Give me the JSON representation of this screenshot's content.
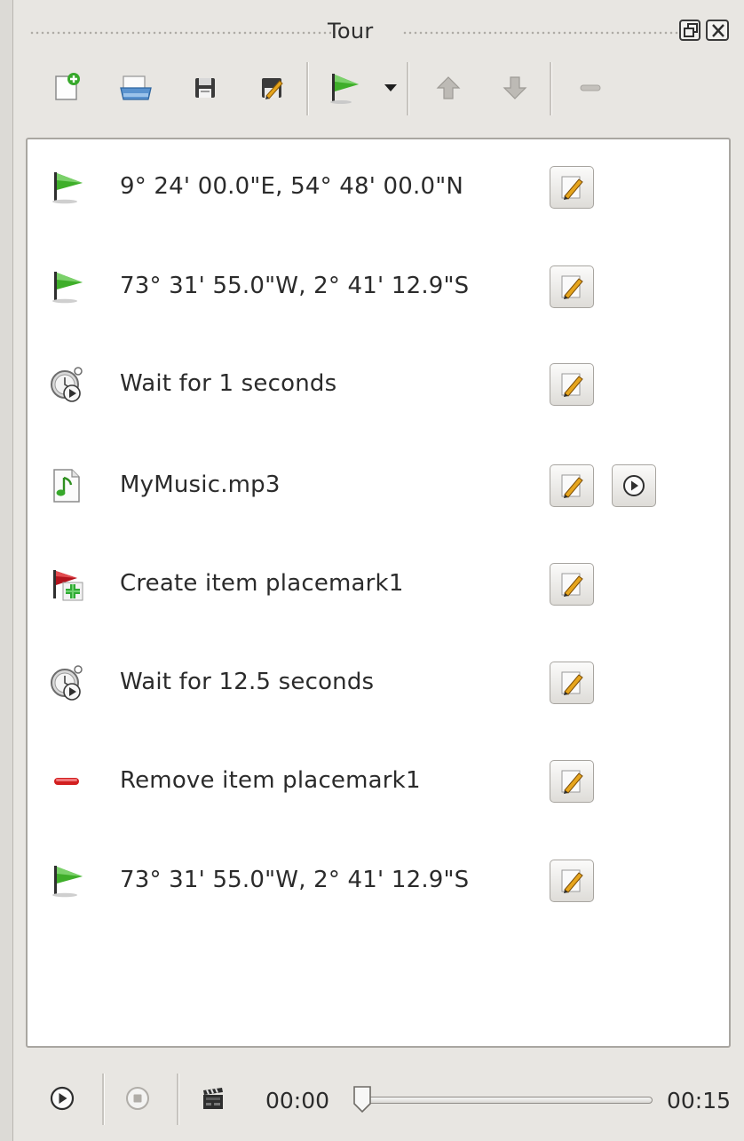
{
  "window": {
    "title": "Tour"
  },
  "toolbar": {
    "buttons": [
      "new-tour",
      "open-tour",
      "save-tour",
      "save-as",
      "add-flyto",
      "add-menu",
      "move-up",
      "move-down",
      "remove"
    ]
  },
  "items": [
    {
      "type": "flyto",
      "icon": "green-flag-icon",
      "label": "9° 24' 00.0\"E, 54° 48' 00.0\"N",
      "playable": false
    },
    {
      "type": "flyto",
      "icon": "green-flag-icon",
      "label": "73° 31' 55.0\"W, 2° 41' 12.9\"S",
      "playable": false
    },
    {
      "type": "wait",
      "icon": "wait-clock-icon",
      "label": "Wait for 1 seconds",
      "playable": false
    },
    {
      "type": "sound",
      "icon": "music-file-icon",
      "label": "MyMusic.mp3",
      "playable": true
    },
    {
      "type": "create",
      "icon": "create-placemark-icon",
      "label": "Create item placemark1",
      "playable": false
    },
    {
      "type": "wait",
      "icon": "wait-clock-icon",
      "label": "Wait for 12.5 seconds",
      "playable": false
    },
    {
      "type": "remove",
      "icon": "remove-icon",
      "label": "Remove item placemark1",
      "playable": false
    },
    {
      "type": "flyto",
      "icon": "green-flag-icon",
      "label": "73° 31' 55.0\"W, 2° 41' 12.9\"S",
      "playable": false
    }
  ],
  "playback": {
    "current_time": "00:00",
    "total_time": "00:15",
    "progress": 0
  },
  "colors": {
    "flag_green": "#3fae2a",
    "remove_red": "#d21f1f",
    "panel_bg": "#e8e6e2"
  }
}
